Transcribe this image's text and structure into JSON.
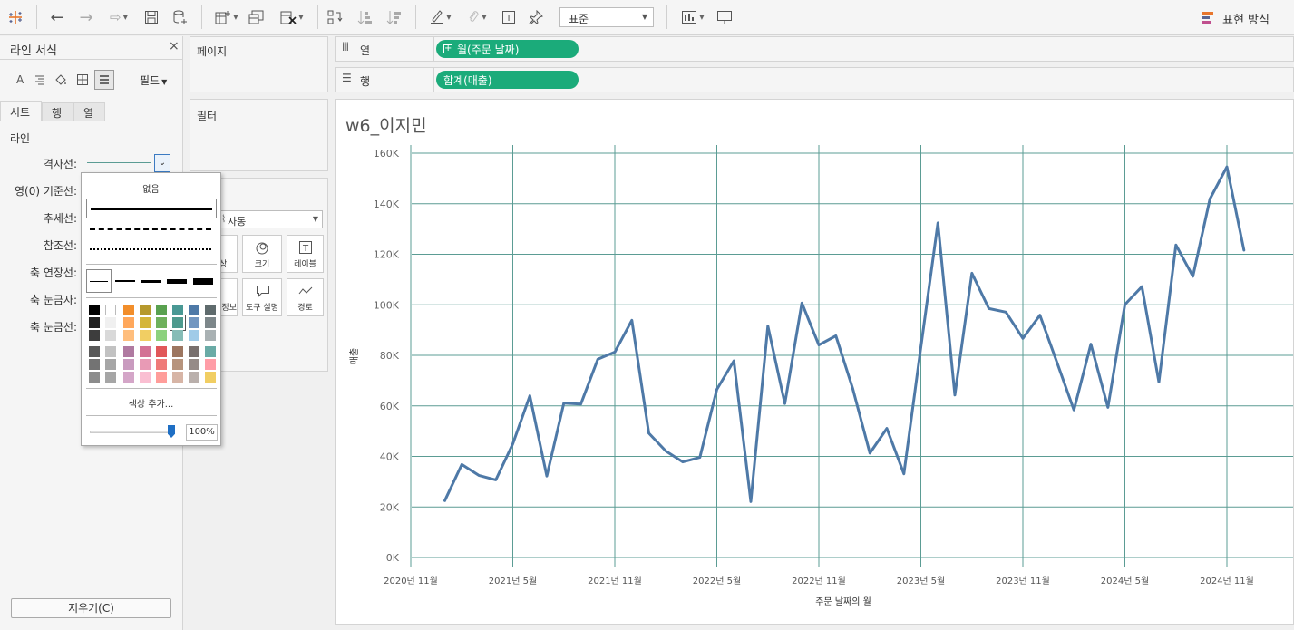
{
  "toolbar": {
    "standard_select": "표준",
    "show_me_label": "표현 방식"
  },
  "format_pane": {
    "title": "라인 서식",
    "fields_label": "필드",
    "tabs": [
      "시트",
      "행",
      "열"
    ],
    "section": "라인",
    "rows": [
      "격자선:",
      "영(0) 기준선:",
      "추세선:",
      "참조선:",
      "축 연장선:",
      "축 눈금자:",
      "축 눈금선:"
    ],
    "clear_button": "지우기(C)"
  },
  "line_popup": {
    "none_label": "없음",
    "more_colors": "색상 추가...",
    "opacity": "100%",
    "selected_color": "#4e9a8e",
    "palette_columns": [
      [
        "#000000",
        "#222222",
        "#3d3d3d",
        "#595959",
        "#737373",
        "#8c8c8c"
      ],
      [
        "#ffffff",
        "#f0f0f0",
        "#d9d9d9",
        "#c2c2c2",
        "#a6a6a6",
        "#a6a6a6"
      ],
      [
        "#f28e2b",
        "#ffa85c",
        "#ffbe7d",
        "#b07aa1",
        "#c99bbf",
        "#d4a6c8"
      ],
      [
        "#b6992d",
        "#d4b53a",
        "#f1ce63",
        "#d37295",
        "#e89ab5",
        "#fabfd2"
      ],
      [
        "#59a14f",
        "#6fb15c",
        "#8cd17d",
        "#e15759",
        "#ef7a78",
        "#ff9d9a"
      ],
      [
        "#499894",
        "#4e9a8e",
        "#86bcb6",
        "#9d7660",
        "#b7947d",
        "#d7b5a6"
      ],
      [
        "#4e79a7",
        "#7296c0",
        "#a0cbe8",
        "#79706e",
        "#968b87",
        "#bab0ac"
      ],
      [
        "#5f6b6d",
        "#7d878a",
        "#a9b1b3",
        "#6aaba6",
        "#ff9da7",
        "#f1ce63"
      ]
    ]
  },
  "marks_card": {
    "mark_type": "자동",
    "buttons": [
      "색상",
      "크기",
      "레이블",
      "세부 정보",
      "도구 설명",
      "경로"
    ]
  },
  "shelves": {
    "pages": "페이지",
    "filters": "필터",
    "columns_label": "열",
    "rows_label": "행",
    "columns_pill": "월(주문 날짜)",
    "rows_pill": "합계(매출)"
  },
  "chart_data": {
    "type": "line",
    "title": "w6_이지민",
    "xlabel": "주문 날짜의 월",
    "ylabel": "매출",
    "ylim": [
      0,
      160000
    ],
    "y_ticks": [
      "0K",
      "20K",
      "40K",
      "60K",
      "80K",
      "100K",
      "120K",
      "140K",
      "160K"
    ],
    "x_ticks": [
      "2020년 11월",
      "2021년 5월",
      "2021년 11월",
      "2022년 5월",
      "2022년 11월",
      "2023년 5월",
      "2023년 11월",
      "2024년 5월",
      "2024년 11월"
    ],
    "x": [
      "2021-01",
      "2021-02",
      "2021-03",
      "2021-04",
      "2021-05",
      "2021-06",
      "2021-07",
      "2021-08",
      "2021-09",
      "2021-10",
      "2021-11",
      "2021-12",
      "2022-01",
      "2022-02",
      "2022-03",
      "2022-04",
      "2022-05",
      "2022-06",
      "2022-07",
      "2022-08",
      "2022-09",
      "2022-10",
      "2022-11",
      "2022-12",
      "2023-01",
      "2023-02",
      "2023-03",
      "2023-04",
      "2023-05",
      "2023-06",
      "2023-07",
      "2023-08",
      "2023-09",
      "2023-10",
      "2023-11",
      "2023-12",
      "2024-01",
      "2024-02",
      "2024-03",
      "2024-04",
      "2024-05",
      "2024-06",
      "2024-07",
      "2024-08",
      "2024-09",
      "2024-10",
      "2024-11",
      "2024-12"
    ],
    "values": [
      22500,
      36800,
      32500,
      30700,
      45000,
      64000,
      32200,
      61100,
      60700,
      78500,
      81300,
      93900,
      49200,
      42100,
      37800,
      39600,
      66500,
      77800,
      22100,
      91600,
      60900,
      100700,
      84100,
      87700,
      66700,
      41300,
      51100,
      33100,
      83200,
      132400,
      64300,
      112500,
      98500,
      97100,
      86700,
      95900,
      77300,
      58400,
      84400,
      59400,
      100100,
      107200,
      69400,
      123700,
      111300,
      141900,
      154600,
      121600
    ],
    "color": "#4e79a7",
    "grid_color": "#5b9c94"
  }
}
